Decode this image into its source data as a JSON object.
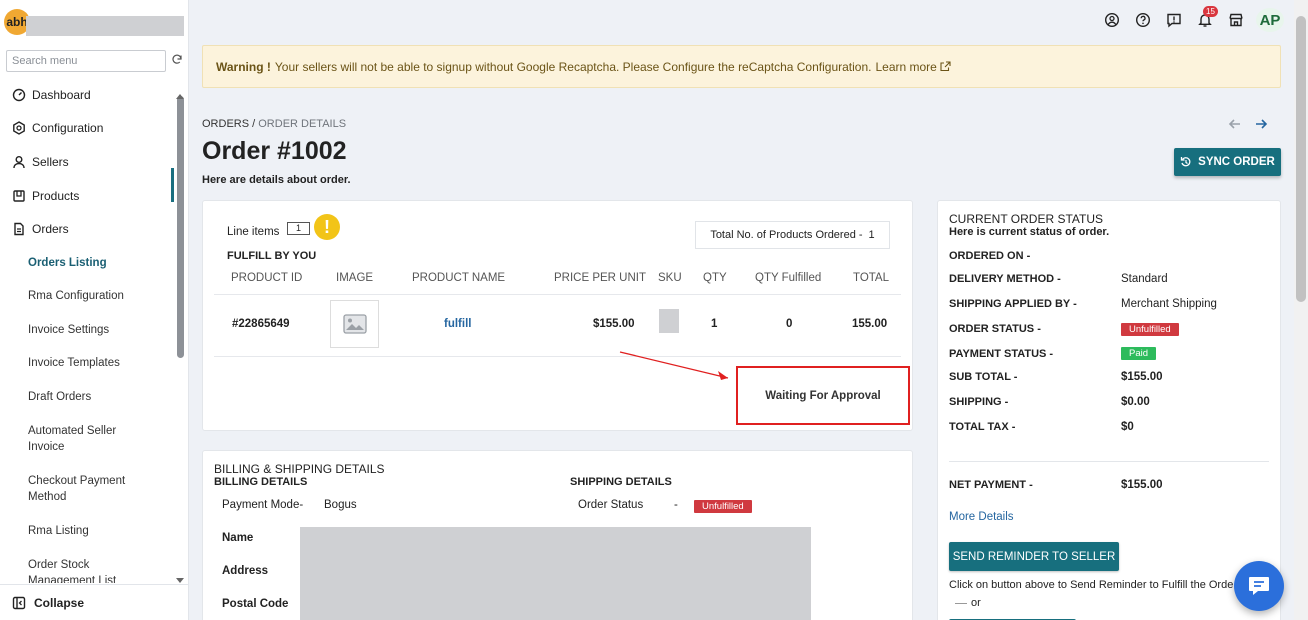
{
  "sidebar": {
    "logo_text": "abh",
    "search_placeholder": "Search menu",
    "items": [
      {
        "label": "Dashboard",
        "icon": "dashboard-icon"
      },
      {
        "label": "Configuration",
        "icon": "gear-icon"
      },
      {
        "label": "Sellers",
        "icon": "user-icon"
      },
      {
        "label": "Products",
        "icon": "product-icon"
      },
      {
        "label": "Orders",
        "icon": "document-icon"
      }
    ],
    "sub_items": [
      "Orders Listing",
      "Rma Configuration",
      "Invoice Settings",
      "Invoice Templates",
      "Draft Orders",
      "Automated Seller Invoice",
      "Checkout Payment Method",
      "Rma Listing",
      "Order Stock Management List"
    ],
    "active_sub": "Orders Listing",
    "collapse_label": "Collapse"
  },
  "topbar": {
    "notification_count": "15",
    "avatar_initials": "AP",
    "icons": [
      "account-icon",
      "help-icon",
      "feedback-icon",
      "bell-icon",
      "store-icon"
    ]
  },
  "warning": {
    "bold": "Warning !",
    "text": "Your sellers will not be able to signup without Google Recaptcha. Please Configure the reCaptcha Configuration.",
    "link": "Learn more"
  },
  "breadcrumb": {
    "root": "ORDERS",
    "sep": "/",
    "current": "ORDER DETAILS"
  },
  "page": {
    "title": "Order #1002",
    "subtitle": "Here are details about order.",
    "sync_label": "SYNC ORDER"
  },
  "line_items": {
    "label": "Line items",
    "count": "1",
    "total_products_label": "Total No. of Products Ordered -",
    "total_products": "1",
    "fulfill_by": "FULFILL BY YOU",
    "columns": [
      "PRODUCT ID",
      "IMAGE",
      "PRODUCT NAME",
      "PRICE PER UNIT",
      "SKU",
      "QTY",
      "QTY Fulfilled",
      "TOTAL"
    ],
    "row": {
      "product_id": "#22865649",
      "product_name": "fulfill",
      "price": "$155.00",
      "qty": "1",
      "qty_fulfilled": "0",
      "total": "155.00"
    },
    "approval_text": "Waiting For Approval"
  },
  "billing": {
    "title": "BILLING & SHIPPING DETAILS",
    "billing_header": "BILLING DETAILS",
    "shipping_header": "SHIPPING DETAILS",
    "payment_mode_label": "Payment Mode-",
    "payment_mode": "Bogus",
    "order_status_label": "Order Status",
    "order_status_sep": "-",
    "order_status": "Unfulfilled",
    "name_label": "Name",
    "address_label": "Address",
    "postal_label": "Postal Code"
  },
  "status": {
    "title": "CURRENT ORDER STATUS",
    "subtitle": "Here is current status of order.",
    "ordered_on_label": "ORDERED ON -",
    "delivery_label": "DELIVERY METHOD -",
    "delivery": "Standard",
    "shipping_by_label": "SHIPPING APPLIED BY -",
    "shipping_by": "Merchant Shipping",
    "order_status_label": "ORDER STATUS -",
    "order_status": "Unfulfilled",
    "payment_status_label": "PAYMENT STATUS -",
    "payment_status": "Paid",
    "subtotal_label": "SUB TOTAL -",
    "subtotal": "$155.00",
    "shipping_label": "SHIPPING -",
    "shipping": "$0.00",
    "tax_label": "TOTAL TAX -",
    "tax": "$0",
    "net_label": "NET PAYMENT -",
    "net": "$155.00",
    "more_details": "More Details",
    "remind_label": "SEND REMINDER TO SELLER",
    "remind_note": "Click on button above to Send Reminder to Fulfill the Orde",
    "or": "or"
  },
  "colors": {
    "accent": "#176f7e",
    "warning_bg": "#fcf3dc",
    "unfulfilled": "#d0393f",
    "paid": "#2dbb5c",
    "chat": "#2b6fdb"
  }
}
